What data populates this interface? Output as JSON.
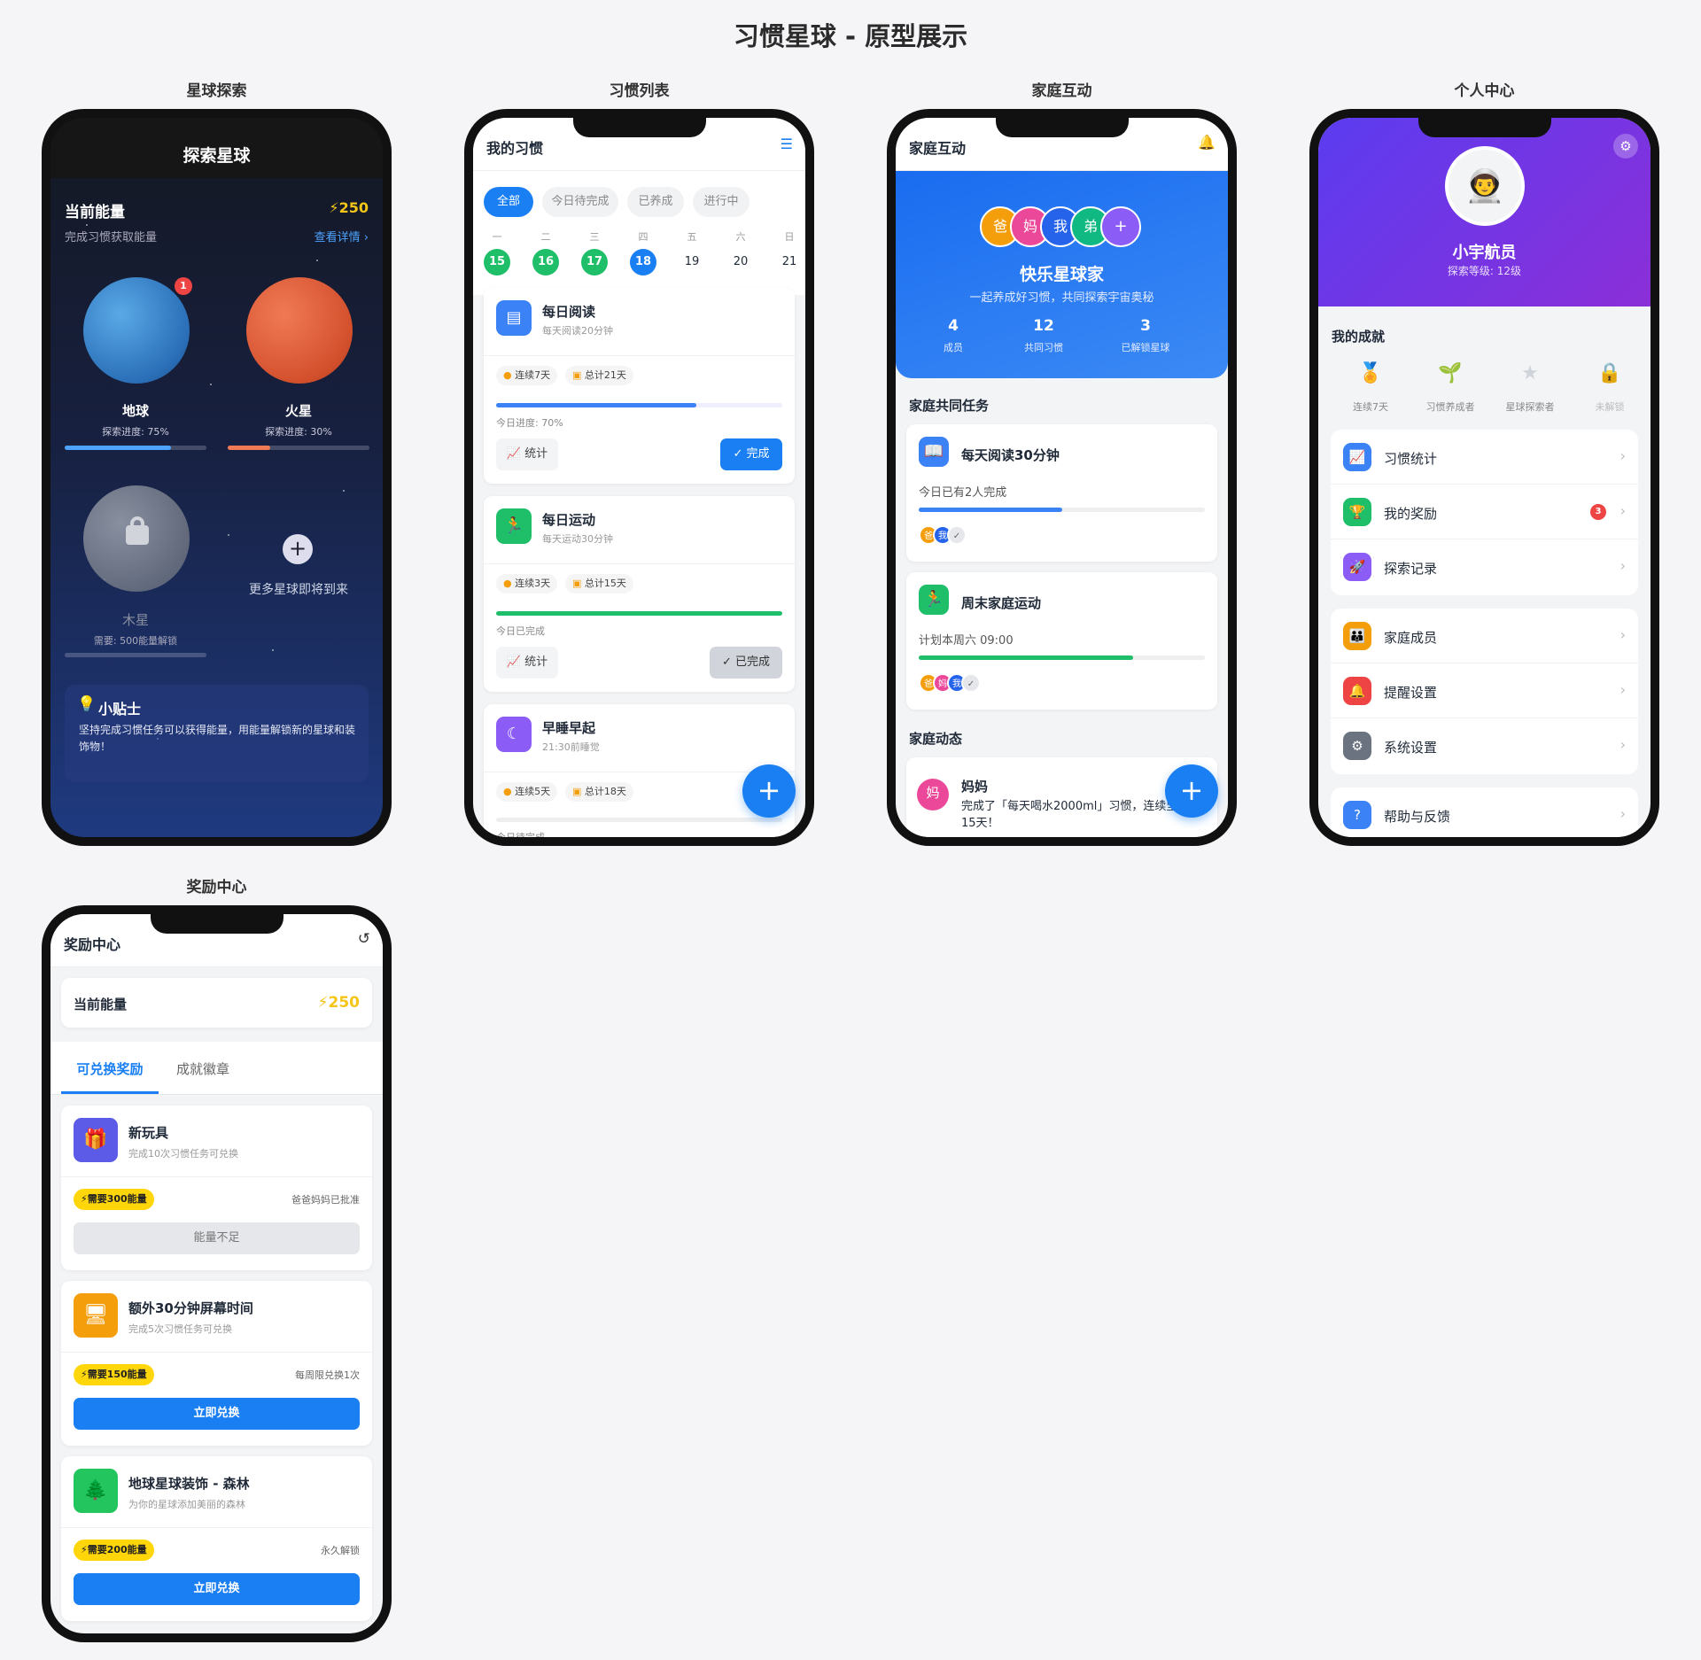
{
  "page_title": "习惯星球 - 原型展示",
  "labels": {
    "explore": "星球探索",
    "habits": "习惯列表",
    "family": "家庭互动",
    "profile": "个人中心",
    "rewards": "奖励中心"
  },
  "explore": {
    "title": "探索星球",
    "energy_label": "当前能量",
    "energy_value": "⚡250",
    "energy_sub": "完成习惯获取能量",
    "details": "查看详情 ›",
    "planets": [
      {
        "name": "地球",
        "progress": "探索进度: 75%",
        "pct": 0.75,
        "badge": "1"
      },
      {
        "name": "火星",
        "progress": "探索进度: 30%",
        "pct": 0.3
      },
      {
        "name": "木星",
        "progress": "需要: 500能量解锁"
      }
    ],
    "more": "更多星球即将到来",
    "tip_title": "小贴士",
    "tip_text": "坚持完成习惯任务可以获得能量，用能量解锁新的星球和装饰物！"
  },
  "habits": {
    "title": "我的习惯",
    "filters": [
      "全部",
      "今日待完成",
      "已养成",
      "进行中"
    ],
    "weekdays": [
      "一",
      "二",
      "三",
      "四",
      "五",
      "六",
      "日"
    ],
    "dates": [
      "15",
      "16",
      "17",
      "18",
      "19",
      "20",
      "21"
    ],
    "items": [
      {
        "name": "每日阅读",
        "sub": "每天阅读20分钟",
        "streak": "连续7天",
        "total": "总计21天",
        "status": "今日进度: 70%",
        "pct": 0.7,
        "stats": "统计",
        "action": "完成"
      },
      {
        "name": "每日运动",
        "sub": "每天运动30分钟",
        "streak": "连续3天",
        "total": "总计15天",
        "status": "今日已完成",
        "pct": 1.0,
        "stats": "统计",
        "action": "已完成"
      },
      {
        "name": "早睡早起",
        "sub": "21:30前睡觉",
        "streak": "连续5天",
        "total": "总计18天",
        "status": "今日待完成",
        "pct": 0
      }
    ],
    "fab": "+"
  },
  "family": {
    "title": "家庭互动",
    "members": [
      "爸",
      "妈",
      "我",
      "弟",
      "+"
    ],
    "name": "快乐星球家",
    "slogan": "一起养成好习惯，共同探索宇宙奥秘",
    "stats": [
      {
        "v": "4",
        "l": "成员"
      },
      {
        "v": "12",
        "l": "共同习惯"
      },
      {
        "v": "3",
        "l": "已解锁星球"
      }
    ],
    "tasks_title": "家庭共同任务",
    "tasks": [
      {
        "name": "每天阅读30分钟",
        "sub": "今日已有2人完成",
        "pct": 0.5,
        "avatars": [
          "爸",
          "我"
        ]
      },
      {
        "name": "周末家庭运动",
        "sub": "计划本周六 09:00",
        "pct": 0.75,
        "avatars": [
          "爸",
          "妈",
          "我"
        ]
      }
    ],
    "feed_title": "家庭动态",
    "feed": {
      "who": "妈妈",
      "avatar": "妈",
      "text": "完成了「每天喝水2000ml」习惯，连续坚持15天！"
    }
  },
  "profile": {
    "name": "小宇航员",
    "level": "探索等级: 12级",
    "ach_title": "我的成就",
    "achievements": [
      "连续7天",
      "习惯养成者",
      "星球探索者",
      "未解锁"
    ],
    "menu1": [
      {
        "label": "习惯统计",
        "icon": "chart-icon"
      },
      {
        "label": "我的奖励",
        "icon": "trophy-icon",
        "badge": "3"
      },
      {
        "label": "探索记录",
        "icon": "rocket-icon"
      }
    ],
    "menu2": [
      {
        "label": "家庭成员",
        "icon": "users-icon"
      },
      {
        "label": "提醒设置",
        "icon": "bell-icon"
      },
      {
        "label": "系统设置",
        "icon": "gear-icon"
      }
    ],
    "menu3": [
      {
        "label": "帮助与反馈",
        "icon": "help-icon"
      }
    ]
  },
  "rewards": {
    "title": "奖励中心",
    "energy_label": "当前能量",
    "energy_value": "⚡250",
    "tabs": [
      "可兑换奖励",
      "成就徽章"
    ],
    "items": [
      {
        "name": "新玩具",
        "sub": "完成10次习惯任务可兑换",
        "cost": "⚡需要300能量",
        "note": "爸爸妈妈已批准",
        "btn": "能量不足",
        "disabled": true
      },
      {
        "name": "额外30分钟屏幕时间",
        "sub": "完成5次习惯任务可兑换",
        "cost": "⚡需要150能量",
        "note": "每周限兑换1次",
        "btn": "立即兑换"
      },
      {
        "name": "地球星球装饰 - 森林",
        "sub": "为你的星球添加美丽的森林",
        "cost": "⚡需要200能量",
        "note": "永久解锁",
        "btn": "立即兑换"
      }
    ]
  },
  "colors": {
    "primary": "#1a7ff2",
    "green": "#1fbf6a",
    "orange": "#f5a623",
    "purple": "#7b3fe4"
  }
}
